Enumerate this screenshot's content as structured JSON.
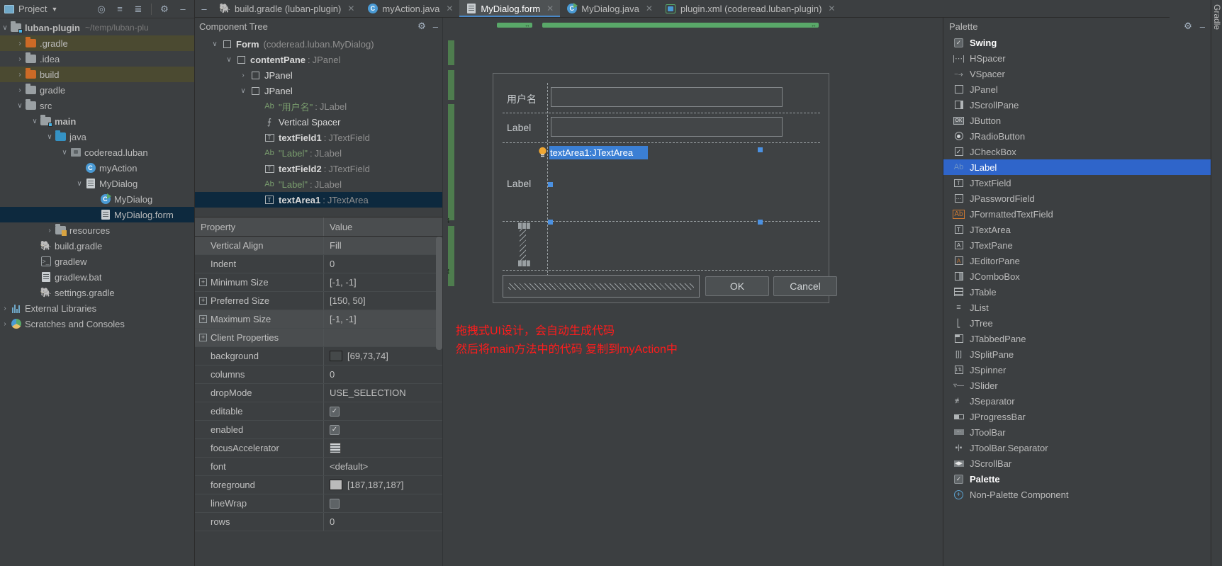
{
  "project_panel": {
    "title": "Project",
    "toolbar_icons": [
      "locate-icon",
      "expand-all-icon",
      "collapse-all-icon",
      "settings-icon",
      "hide-icon"
    ],
    "root": {
      "label": "luban-plugin",
      "path": "~/temp/luban-plu"
    },
    "tree": [
      {
        "label": ".gradle",
        "indent": 1,
        "arrow": "›",
        "icon": "folder-orange",
        "highlight": "olive"
      },
      {
        "label": ".idea",
        "indent": 1,
        "arrow": "›",
        "icon": "folder-gray",
        "highlight": "none"
      },
      {
        "label": "build",
        "indent": 1,
        "arrow": "›",
        "icon": "folder-orange",
        "highlight": "olive"
      },
      {
        "label": "gradle",
        "indent": 1,
        "arrow": "›",
        "icon": "folder-gray",
        "highlight": "none"
      },
      {
        "label": "src",
        "indent": 1,
        "arrow": "∨",
        "icon": "folder-gray",
        "highlight": "none"
      },
      {
        "label": "main",
        "indent": 2,
        "arrow": "∨",
        "icon": "folder-gray-badge",
        "bold": true,
        "highlight": "none"
      },
      {
        "label": "java",
        "indent": 3,
        "arrow": "∨",
        "icon": "folder-blue",
        "highlight": "none"
      },
      {
        "label": "coderead.luban",
        "indent": 4,
        "arrow": "∨",
        "icon": "package",
        "highlight": "none"
      },
      {
        "label": "myAction",
        "indent": 5,
        "arrow": "",
        "icon": "class-circle",
        "highlight": "none"
      },
      {
        "label": "MyDialog",
        "indent": 5,
        "arrow": "∨",
        "icon": "form-file",
        "highlight": "none"
      },
      {
        "label": "MyDialog",
        "indent": 6,
        "arrow": "",
        "icon": "class-circle-run",
        "highlight": "none"
      },
      {
        "label": "MyDialog.form",
        "indent": 6,
        "arrow": "",
        "icon": "form-file",
        "highlight": "selected"
      },
      {
        "label": "resources",
        "indent": 3,
        "arrow": "›",
        "icon": "folder-resources",
        "highlight": "none"
      },
      {
        "label": "build.gradle",
        "indent": 2,
        "arrow": "",
        "icon": "gradle-elephant",
        "highlight": "none"
      },
      {
        "label": "gradlew",
        "indent": 2,
        "arrow": "",
        "icon": "shell-script",
        "highlight": "none"
      },
      {
        "label": "gradlew.bat",
        "indent": 2,
        "arrow": "",
        "icon": "bat-file",
        "highlight": "none"
      },
      {
        "label": "settings.gradle",
        "indent": 2,
        "arrow": "",
        "icon": "gradle-elephant",
        "highlight": "none"
      },
      {
        "label": "External Libraries",
        "indent": 0,
        "arrow": "›",
        "icon": "libraries",
        "highlight": "none"
      },
      {
        "label": "Scratches and Consoles",
        "indent": 0,
        "arrow": "›",
        "icon": "scratches",
        "highlight": "none"
      }
    ]
  },
  "tabs": {
    "collapse_icon": "minimize-icon",
    "items": [
      {
        "label": "build.gradle (luban-plugin)",
        "icon": "gradle-elephant-icon",
        "active": false,
        "closable": true
      },
      {
        "label": "myAction.java",
        "icon": "java-class-icon",
        "active": false,
        "closable": true
      },
      {
        "label": "MyDialog.form",
        "icon": "gui-form-icon",
        "active": true,
        "closable": true
      },
      {
        "label": "MyDialog.java",
        "icon": "java-class-run-icon",
        "active": false,
        "closable": true
      },
      {
        "label": "plugin.xml (coderead.luban-plugin)",
        "icon": "xml-plugin-icon",
        "active": false,
        "closable": true
      }
    ]
  },
  "component_tree": {
    "title": "Component Tree",
    "header_icons": [
      "settings-icon",
      "hide-icon"
    ],
    "nodes": [
      {
        "indent": 1,
        "arrow": "∨",
        "icon": "square-icon",
        "name": "Form",
        "sep": "",
        "type": "(coderead.luban.MyDialog)",
        "name_bold": true,
        "selected": false
      },
      {
        "indent": 2,
        "arrow": "∨",
        "icon": "square-icon",
        "name": "contentPane",
        "sep": ":",
        "type": "JPanel",
        "name_bold": true,
        "selected": false
      },
      {
        "indent": 3,
        "arrow": "›",
        "icon": "square-icon",
        "name": "JPanel",
        "sep": "",
        "type": "",
        "name_bold": false,
        "selected": false
      },
      {
        "indent": 3,
        "arrow": "∨",
        "icon": "square-icon",
        "name": "JPanel",
        "sep": "",
        "type": "",
        "name_bold": false,
        "selected": false
      },
      {
        "indent": 4,
        "arrow": "",
        "icon": "ab-icon",
        "name": "\"用户名\"",
        "sep": ":",
        "type": "JLabel",
        "name_bold": false,
        "name_class": "cstr",
        "selected": false
      },
      {
        "indent": 4,
        "arrow": "",
        "icon": "vspacer-icon",
        "name": "Vertical Spacer",
        "sep": "",
        "type": "",
        "name_bold": false,
        "selected": false
      },
      {
        "indent": 4,
        "arrow": "",
        "icon": "textfield-icon",
        "name": "textField1",
        "sep": ":",
        "type": "JTextField",
        "name_bold": true,
        "selected": false
      },
      {
        "indent": 4,
        "arrow": "",
        "icon": "ab-icon",
        "name": "\"Label\"",
        "sep": ":",
        "type": "JLabel",
        "name_bold": false,
        "name_class": "cstr",
        "selected": false
      },
      {
        "indent": 4,
        "arrow": "",
        "icon": "textfield-icon",
        "name": "textField2",
        "sep": ":",
        "type": "JTextField",
        "name_bold": true,
        "selected": false
      },
      {
        "indent": 4,
        "arrow": "",
        "icon": "ab-icon",
        "name": "\"Label\"",
        "sep": ":",
        "type": "JLabel",
        "name_bold": false,
        "name_class": "cstr",
        "selected": false
      },
      {
        "indent": 4,
        "arrow": "",
        "icon": "textarea-icon",
        "name": "textArea1",
        "sep": ":",
        "type": "JTextArea",
        "name_bold": true,
        "selected": true
      }
    ]
  },
  "properties": {
    "col_property": "Property",
    "col_value": "Value",
    "rows": [
      {
        "name": "Vertical Align",
        "value": "Fill",
        "expander": false,
        "indent": true,
        "kind": "text",
        "alt": true
      },
      {
        "name": "Indent",
        "value": "0",
        "expander": false,
        "indent": true,
        "kind": "text",
        "alt": false
      },
      {
        "name": "Minimum Size",
        "value": "[-1, -1]",
        "expander": true,
        "indent": false,
        "kind": "text",
        "alt": false
      },
      {
        "name": "Preferred Size",
        "value": "[150, 50]",
        "expander": true,
        "indent": false,
        "kind": "text",
        "alt": false
      },
      {
        "name": "Maximum Size",
        "value": "[-1, -1]",
        "expander": true,
        "indent": false,
        "kind": "text",
        "alt": true
      },
      {
        "name": "Client Properties",
        "value": "",
        "expander": true,
        "indent": false,
        "kind": "text",
        "alt": true
      },
      {
        "name": "background",
        "value": "[69,73,74]",
        "expander": false,
        "indent": true,
        "kind": "color",
        "swatch": "#45494a",
        "alt": false
      },
      {
        "name": "columns",
        "value": "0",
        "expander": false,
        "indent": true,
        "kind": "text",
        "alt": false
      },
      {
        "name": "dropMode",
        "value": "USE_SELECTION",
        "expander": false,
        "indent": true,
        "kind": "text",
        "alt": false
      },
      {
        "name": "editable",
        "value": "",
        "expander": false,
        "indent": true,
        "kind": "checkbox-on",
        "alt": false
      },
      {
        "name": "enabled",
        "value": "",
        "expander": false,
        "indent": true,
        "kind": "checkbox-on",
        "alt": false
      },
      {
        "name": "focusAccelerator",
        "value": "",
        "expander": false,
        "indent": true,
        "kind": "stripes",
        "alt": false
      },
      {
        "name": "font",
        "value": "<default>",
        "expander": false,
        "indent": true,
        "kind": "text",
        "alt": false
      },
      {
        "name": "foreground",
        "value": "[187,187,187]",
        "expander": false,
        "indent": true,
        "kind": "color",
        "swatch": "#bbbbbb",
        "alt": false
      },
      {
        "name": "lineWrap",
        "value": "",
        "expander": false,
        "indent": true,
        "kind": "checkbox-off",
        "alt": false
      },
      {
        "name": "rows",
        "value": "0",
        "expander": false,
        "indent": true,
        "kind": "text",
        "alt": false
      }
    ]
  },
  "designer": {
    "form_labels": {
      "username": "用户名",
      "label2": "Label",
      "label3": "Label"
    },
    "selected_component_text": "textArea1:JTextArea",
    "buttons": {
      "ok": "OK",
      "cancel": "Cancel"
    },
    "annotation_line1": "拖拽式UI设计，会自动生成代码",
    "annotation_line2": "然后将main方法中的代码 复制到myAction中",
    "annotation_color": "#ff1c1c",
    "selection_color": "#4b91e2"
  },
  "palette": {
    "title": "Palette",
    "header_icons": [
      "settings-icon",
      "hide-icon"
    ],
    "groups": [
      {
        "label": "Swing",
        "icon": "checkbox-checked-icon",
        "checked": true,
        "items": [
          {
            "label": "HSpacer",
            "icon": "hspacer-icon",
            "selected": false
          },
          {
            "label": "VSpacer",
            "icon": "vspacer-icon",
            "selected": false
          },
          {
            "label": "JPanel",
            "icon": "panel-icon",
            "selected": false
          },
          {
            "label": "JScrollPane",
            "icon": "scrollpane-icon",
            "selected": false
          },
          {
            "label": "JButton",
            "icon": "button-icon",
            "selected": false
          },
          {
            "label": "JRadioButton",
            "icon": "radio-icon",
            "selected": false
          },
          {
            "label": "JCheckBox",
            "icon": "checkbox-icon",
            "selected": false
          },
          {
            "label": "JLabel",
            "icon": "label-ab-icon",
            "selected": true
          },
          {
            "label": "JTextField",
            "icon": "textfield-icon",
            "selected": false
          },
          {
            "label": "JPasswordField",
            "icon": "password-icon",
            "selected": false
          },
          {
            "label": "JFormattedTextField",
            "icon": "formatted-ab-icon",
            "selected": false
          },
          {
            "label": "JTextArea",
            "icon": "textarea-icon",
            "selected": false
          },
          {
            "label": "JTextPane",
            "icon": "textpane-icon",
            "selected": false
          },
          {
            "label": "JEditorPane",
            "icon": "editorpane-icon",
            "selected": false
          },
          {
            "label": "JComboBox",
            "icon": "combobox-icon",
            "selected": false
          },
          {
            "label": "JTable",
            "icon": "table-icon",
            "selected": false
          },
          {
            "label": "JList",
            "icon": "list-icon",
            "selected": false
          },
          {
            "label": "JTree",
            "icon": "tree-icon",
            "selected": false
          },
          {
            "label": "JTabbedPane",
            "icon": "tabbedpane-icon",
            "selected": false
          },
          {
            "label": "JSplitPane",
            "icon": "splitpane-icon",
            "selected": false
          },
          {
            "label": "JSpinner",
            "icon": "spinner-icon",
            "selected": false
          },
          {
            "label": "JSlider",
            "icon": "slider-icon",
            "selected": false
          },
          {
            "label": "JSeparator",
            "icon": "separator-icon",
            "selected": false
          },
          {
            "label": "JProgressBar",
            "icon": "progressbar-icon",
            "selected": false
          },
          {
            "label": "JToolBar",
            "icon": "toolbar-icon",
            "selected": false
          },
          {
            "label": "JToolBar.Separator",
            "icon": "toolbar-sep-icon",
            "selected": false
          },
          {
            "label": "JScrollBar",
            "icon": "scrollbar-icon",
            "selected": false
          }
        ]
      },
      {
        "label": "Palette",
        "icon": "checkbox-checked-icon",
        "checked": true,
        "items": [
          {
            "label": "Non-Palette Component",
            "icon": "non-palette-icon",
            "selected": false
          }
        ]
      }
    ]
  },
  "right_edge": {
    "label": "Gradle"
  }
}
